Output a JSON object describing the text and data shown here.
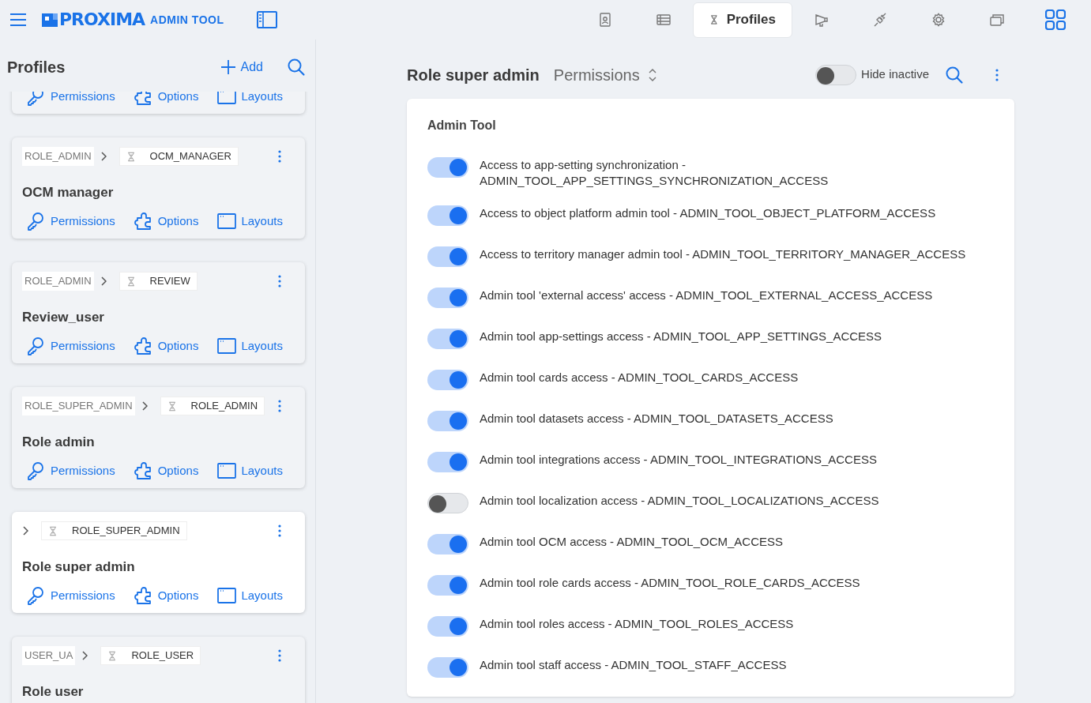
{
  "app": {
    "logo": "PROXIMA",
    "subtitle": "ADMIN TOOL"
  },
  "nav": [
    {
      "selected": false
    },
    {
      "selected": false
    },
    {
      "label": "Profiles",
      "selected": true
    },
    {
      "selected": false
    },
    {
      "selected": false
    },
    {
      "selected": false
    },
    {
      "selected": false
    },
    {
      "selected": false
    }
  ],
  "profiles_panel": {
    "title": "Profiles",
    "add_label": "Add",
    "cards": [
      {
        "actions": [
          "Permissions",
          "Options",
          "Layouts"
        ],
        "selected": false
      },
      {
        "parent": "ROLE_ADMIN",
        "code": "OCM_MANAGER",
        "name": "OCM manager",
        "actions": [
          "Permissions",
          "Options",
          "Layouts"
        ],
        "selected": false
      },
      {
        "parent": "ROLE_ADMIN",
        "code": "REVIEW",
        "name": "Review_user",
        "actions": [
          "Permissions",
          "Options",
          "Layouts"
        ],
        "selected": false
      },
      {
        "parent": "ROLE_SUPER_ADMIN",
        "code": "ROLE_ADMIN",
        "name": "Role admin",
        "actions": [
          "Permissions",
          "Options",
          "Layouts"
        ],
        "selected": false
      },
      {
        "code": "ROLE_SUPER_ADMIN",
        "name": "Role super admin",
        "actions": [
          "Permissions",
          "Options",
          "Layouts"
        ],
        "selected": true
      },
      {
        "parent": "USER_UA",
        "code": "ROLE_USER",
        "name": "Role user",
        "selected": false
      }
    ]
  },
  "detail": {
    "title": "Role super admin",
    "view": "Permissions",
    "hide_inactive": {
      "label": "Hide inactive",
      "on": false
    },
    "section": "Admin Tool",
    "permissions": [
      {
        "label": "Access to app-setting synchronization - ADMIN_TOOL_APP_SETTINGS_SYNCHRONIZATION_ACCESS",
        "on": true
      },
      {
        "label": "Access to object platform admin tool - ADMIN_TOOL_OBJECT_PLATFORM_ACCESS",
        "on": true
      },
      {
        "label": "Access to territory manager admin tool - ADMIN_TOOL_TERRITORY_MANAGER_ACCESS",
        "on": true
      },
      {
        "label": "Admin tool 'external access' access - ADMIN_TOOL_EXTERNAL_ACCESS_ACCESS",
        "on": true
      },
      {
        "label": "Admin tool app-settings access - ADMIN_TOOL_APP_SETTINGS_ACCESS",
        "on": true
      },
      {
        "label": "Admin tool cards access - ADMIN_TOOL_CARDS_ACCESS",
        "on": true
      },
      {
        "label": "Admin tool datasets access - ADMIN_TOOL_DATASETS_ACCESS",
        "on": true
      },
      {
        "label": "Admin tool integrations access - ADMIN_TOOL_INTEGRATIONS_ACCESS",
        "on": true
      },
      {
        "label": "Admin tool localization access - ADMIN_TOOL_LOCALIZATIONS_ACCESS",
        "on": false
      },
      {
        "label": "Admin tool OCM access - ADMIN_TOOL_OCM_ACCESS",
        "on": true
      },
      {
        "label": "Admin tool role cards access - ADMIN_TOOL_ROLE_CARDS_ACCESS",
        "on": true
      },
      {
        "label": "Admin tool roles access - ADMIN_TOOL_ROLES_ACCESS",
        "on": true
      },
      {
        "label": "Admin tool staff access - ADMIN_TOOL_STAFF_ACCESS",
        "on": true
      }
    ]
  }
}
